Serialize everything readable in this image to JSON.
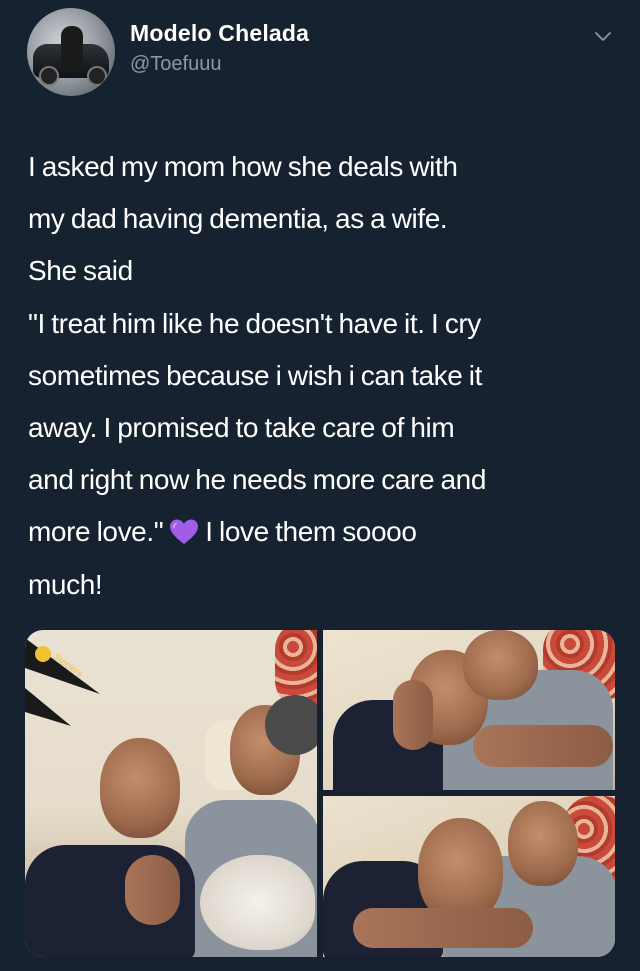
{
  "tweet": {
    "author": {
      "name": "Modelo Chelada",
      "handle": "@Toefuuu",
      "avatar_icon": "profile-photo"
    },
    "menu_icon": "chevron-down-icon",
    "text_lines": [
      "I asked my mom how she deals with",
      "my dad having dementia, as a wife.",
      "She said",
      "\"I treat him like he doesn't have it. I cry",
      "sometimes because i wish i can take it",
      "away. I promised to take care of him",
      "and right now he needs more care and",
      "more love.\"",
      "I love them soooo",
      "much!"
    ],
    "emoji": {
      "name": "purple-heart-icon",
      "color": "#a05ee8"
    },
    "media": {
      "count": 3,
      "pennant_text": "Steelers"
    }
  },
  "colors": {
    "background": "#172230",
    "text_primary": "#ffffff",
    "text_secondary": "#8899a6"
  }
}
